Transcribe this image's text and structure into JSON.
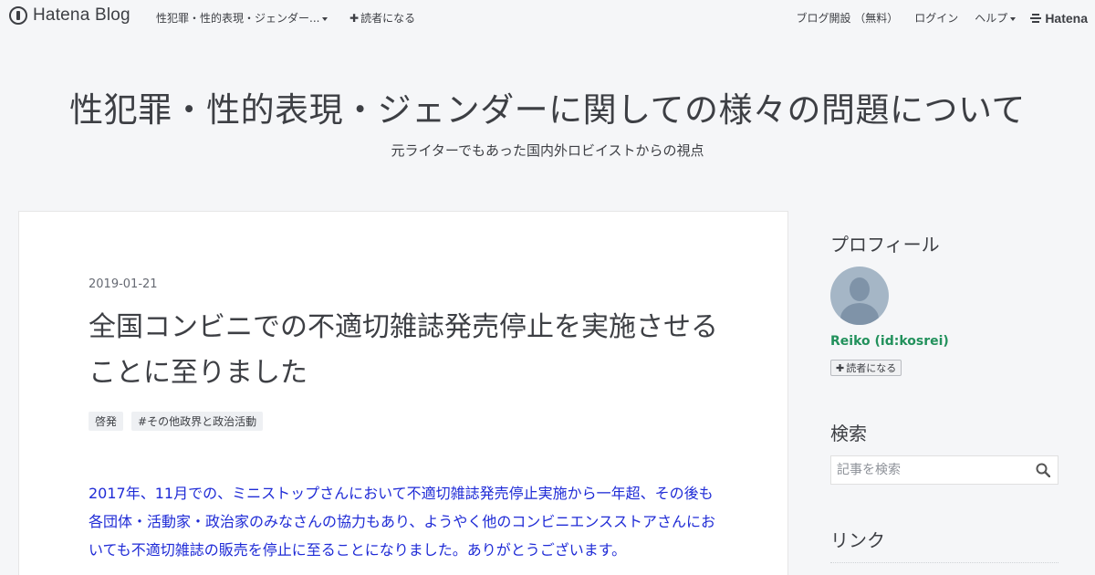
{
  "header": {
    "logo_text": "Hatena Blog",
    "blog_menu": "性犯罪・性的表現・ジェンダー...",
    "subscribe": "読者になる",
    "open_blog": "ブログ開設 （無料）",
    "login": "ログイン",
    "help": "ヘルプ",
    "brand": "Hatena",
    "icons": [
      "hatena-blog-logo-icon",
      "chevron-down-icon",
      "plus-icon",
      "hatena-brand-icon"
    ]
  },
  "blog": {
    "title": "性犯罪・性的表現・ジェンダーに関しての様々の問題について",
    "description": "元ライターでもあった国内外ロビイストからの視点"
  },
  "entry": {
    "date": "2019-01-21",
    "title": "全国コンビニでの不適切雑誌発売停止を実施させることに至りました",
    "categories": [
      "啓発",
      "#その他政界と政治活動"
    ],
    "body": "2017年、11月での、ミニストップさんにおいて不適切雑誌発売停止実施から一年超、その後も各団体・活動家・政治家のみなさんの協力もあり、ようやく他のコンビニエンスストアさんにおいても不適切雑誌の販売を停止に至ることになりました。ありがとうございます。",
    "link_color": "#1f2bd6"
  },
  "sidebar": {
    "profile_title": "プロフィール",
    "profile_name": "Reiko  (id:kosrei)",
    "subscribe_button": "読者になる",
    "search_title": "検索",
    "search_placeholder": "記事を検索",
    "links_title": "リンク",
    "name_color": "#22915c"
  }
}
